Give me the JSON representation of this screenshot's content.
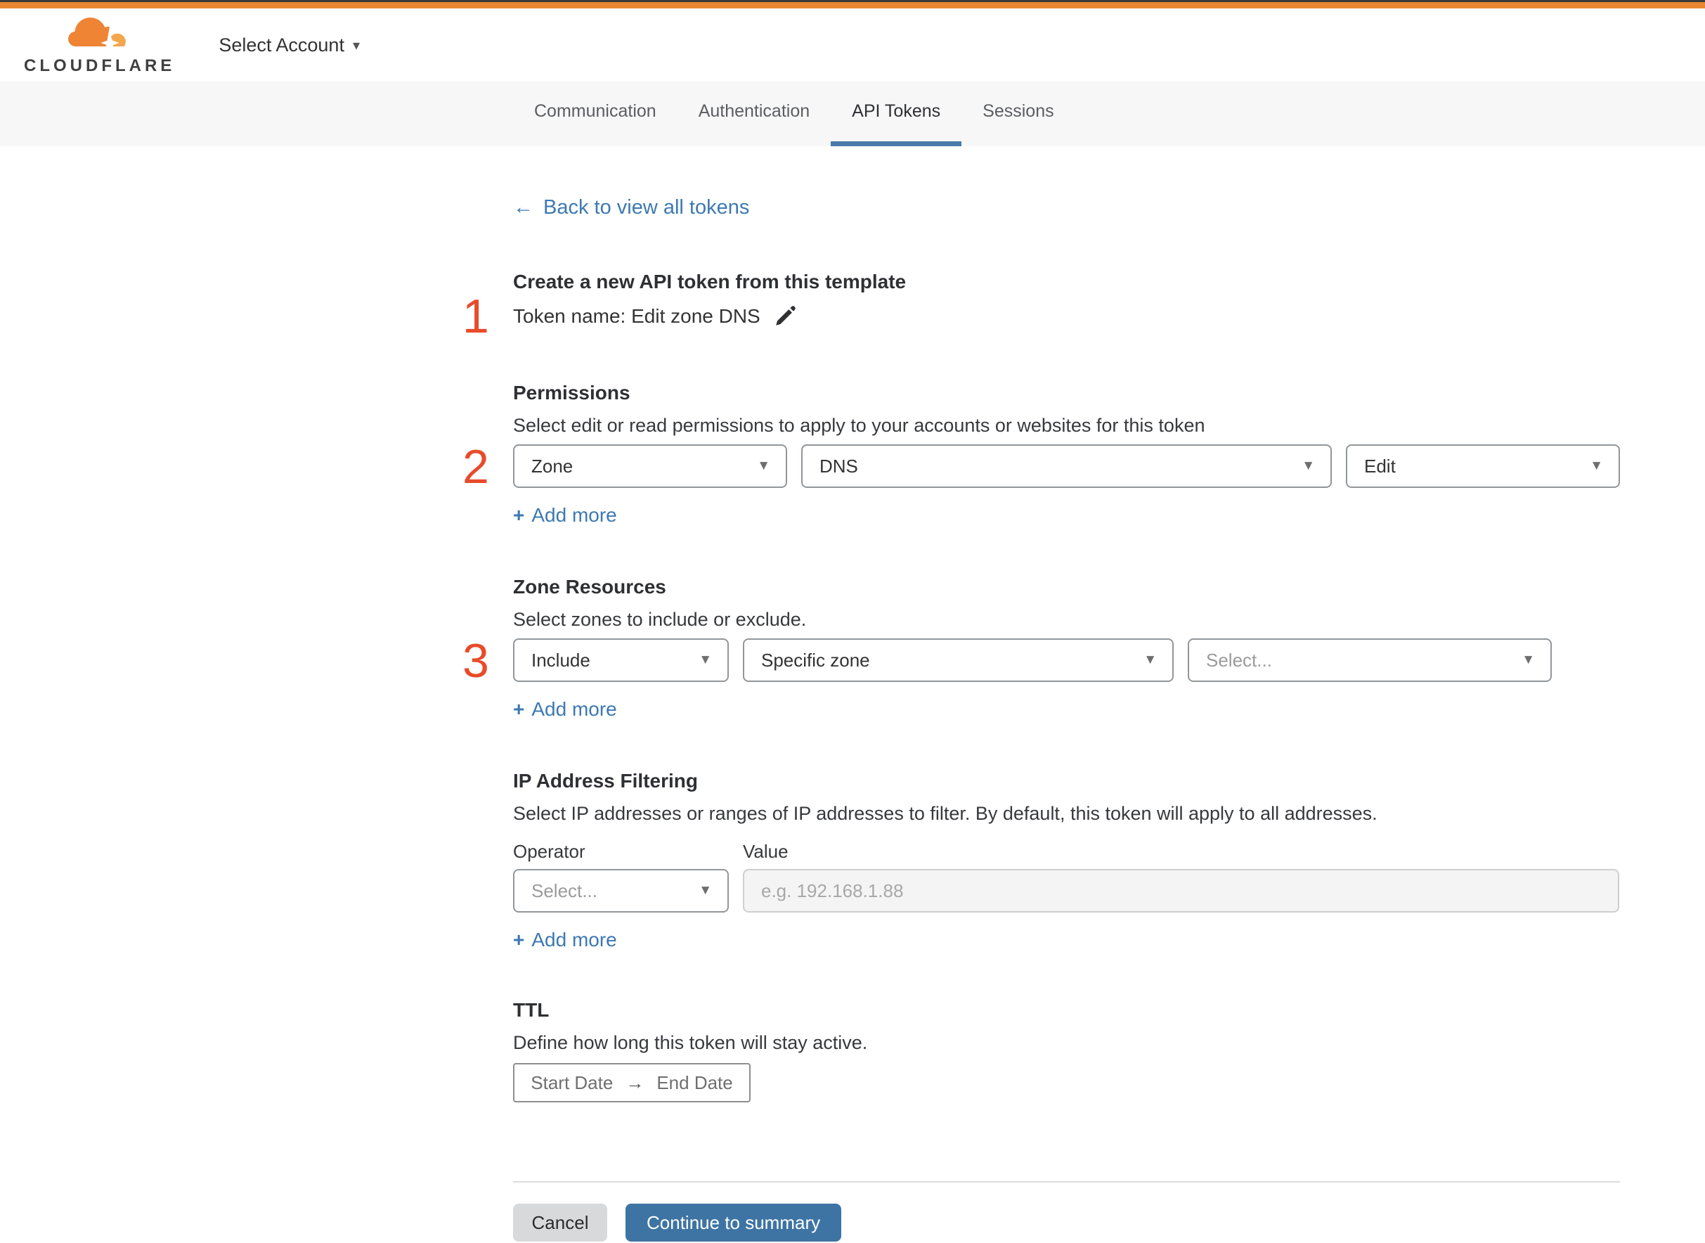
{
  "colors": {
    "orange_bar": "#e8872e",
    "step_number": "#e84b2a",
    "link_blue": "#3d79b2",
    "button_blue": "#3e74a3",
    "tab_underline": "#497aa9",
    "select_border": "#929699"
  },
  "brand": {
    "logo_text": "CLOUDFLARE",
    "account_selector_label": "Select Account"
  },
  "tabs": [
    {
      "label": "Communication",
      "active": false
    },
    {
      "label": "Authentication",
      "active": false
    },
    {
      "label": "API Tokens",
      "active": true
    },
    {
      "label": "Sessions",
      "active": false
    }
  ],
  "ui": {
    "back_arrow": "←",
    "select_caret": "▼",
    "account_caret": "▾",
    "plus": "+",
    "range_arrow": "→"
  },
  "back_link": {
    "label": "Back to view all tokens"
  },
  "form": {
    "title": "Create a new API token from this template",
    "token_name": "Token name: Edit zone DNS",
    "steps": [
      "1",
      "2",
      "3"
    ],
    "permissions": {
      "heading": "Permissions",
      "description": "Select edit or read permissions to apply to your accounts or websites for this token",
      "scope_value": "Zone",
      "resource_value": "DNS",
      "access_value": "Edit",
      "add_more_label": "Add more"
    },
    "zone_resources": {
      "heading": "Zone Resources",
      "description": "Select zones to include or exclude.",
      "mode_value": "Include",
      "scope_value": "Specific zone",
      "zone_placeholder": "Select...",
      "add_more_label": "Add more"
    },
    "ip_filtering": {
      "heading": "IP Address Filtering",
      "description": "Select IP addresses or ranges of IP addresses to filter. By default, this token will apply to all addresses.",
      "operator_label": "Operator",
      "value_label": "Value",
      "operator_placeholder": "Select...",
      "value_placeholder": "e.g. 192.168.1.88",
      "add_more_label": "Add more"
    },
    "ttl": {
      "heading": "TTL",
      "description": "Define how long this token will stay active.",
      "start_placeholder": "Start Date",
      "end_placeholder": "End Date"
    },
    "actions": {
      "cancel_label": "Cancel",
      "continue_label": "Continue to summary"
    }
  }
}
